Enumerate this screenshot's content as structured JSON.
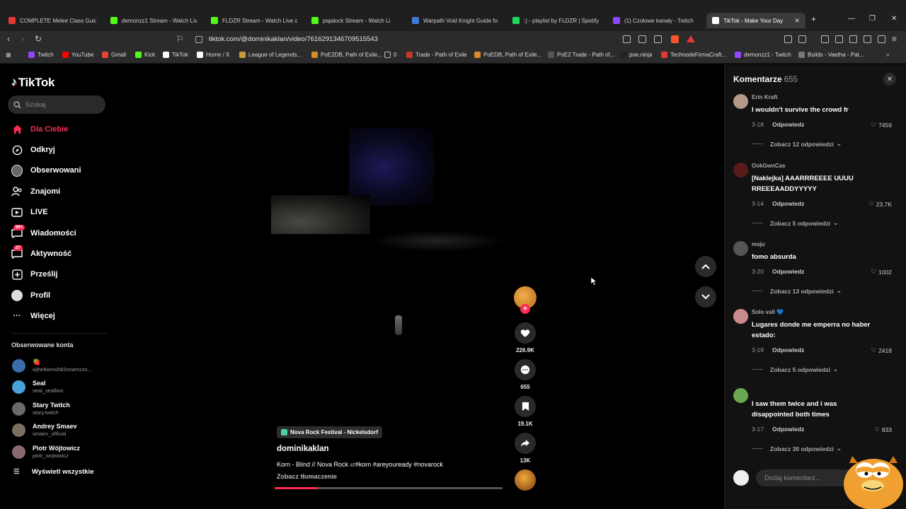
{
  "browser": {
    "tabs": [
      {
        "label": "COMPLETE Melee Class Guide",
        "color": "#e53935"
      },
      {
        "label": "demonzz1 Stream - Watch Live",
        "color": "#53fc18"
      },
      {
        "label": "FLDZR Stream - Watch Live on",
        "color": "#53fc18"
      },
      {
        "label": "pajalock Stream - Watch Li",
        "color": "#53fc18"
      },
      {
        "label": "Warpath Void Knight Guide fo",
        "color": "#3d7bd8"
      },
      {
        "label": ":) - playlist by FLDZR | Spotify",
        "color": "#1ed760"
      },
      {
        "label": "(1) Czołowe kanały - Twitch",
        "color": "#9146ff"
      },
      {
        "label": "TikTok - Make Your Day",
        "color": "#ffffff"
      }
    ],
    "url": "tiktok.com/@dominikaklan/video/7616291346709515543",
    "bookmarks": [
      {
        "label": "Twitch",
        "color": "#9146ff"
      },
      {
        "label": "YouTube",
        "color": "#ff0000"
      },
      {
        "label": "Gmail",
        "color": "#ea4335"
      },
      {
        "label": "Kick",
        "color": "#53fc18"
      },
      {
        "label": "TikTok",
        "color": "#ffffff"
      },
      {
        "label": "Home / X",
        "color": "#ffffff"
      },
      {
        "label": "League of Legends...",
        "color": "#c89b3c"
      },
      {
        "label": "PoE2DB, Path of Exile...",
        "color": "#d98a2b"
      },
      {
        "label": "0",
        "color": "#bbbbbb"
      },
      {
        "label": "Trade - Path of Exile",
        "color": "#c0392b"
      },
      {
        "label": "PoEDB, Path of Exile...",
        "color": "#d98a2b"
      },
      {
        "label": "PoE2 Trade - Path of...",
        "color": "#555555"
      },
      {
        "label": "poe.ninja",
        "color": "#222222"
      },
      {
        "label": "TechnodeFirmaCraft...",
        "color": "#e53935"
      },
      {
        "label": "demonzz1 - Twitch",
        "color": "#9146ff"
      },
      {
        "label": "Builds - Vaetha - Pat...",
        "color": "#777777"
      }
    ]
  },
  "sidebar": {
    "logo": "TikTok",
    "search_placeholder": "Szukaj",
    "nav": [
      {
        "label": "Dla Ciebie",
        "icon": "home-icon"
      },
      {
        "label": "Odkryj",
        "icon": "compass-icon"
      },
      {
        "label": "Obserwowani",
        "icon": "following-icon"
      },
      {
        "label": "Znajomi",
        "icon": "friends-icon"
      },
      {
        "label": "LIVE",
        "icon": "live-icon"
      },
      {
        "label": "Wiadomości",
        "icon": "messages-icon",
        "badge": "99+"
      },
      {
        "label": "Aktywność",
        "icon": "activity-icon",
        "badge": "27"
      },
      {
        "label": "Prześlij",
        "icon": "upload-icon"
      },
      {
        "label": "Profil",
        "icon": "profile-icon"
      },
      {
        "label": "Więcej",
        "icon": "more-icon"
      }
    ],
    "followed_title": "Obserwowane konta",
    "followed": [
      {
        "name": "🍓",
        "handle": "wjhe8wmsh82nnamzzs...",
        "color": "#3b6ea8"
      },
      {
        "name": "Seal",
        "handle": "seal_seallion",
        "color": "#4aa3d8"
      },
      {
        "name": "Stary Twitch",
        "handle": "stary.twitch",
        "color": "#6a6a6a"
      },
      {
        "name": "Andrey Smaev",
        "handle": "smaev_official",
        "color": "#7a7060"
      },
      {
        "name": "Piotr Wójtowicz",
        "handle": "piotr_wojtowicz",
        "color": "#8a6a70"
      }
    ],
    "see_all": "Wyświetl wszystkie"
  },
  "video": {
    "location": "Nova Rock Festival - Nickelsdorf",
    "author": "dominikaklan",
    "description_pre": "Korn - Blind // Nova Rock ",
    "description_at": "AT",
    "description_post": "#korn #areyouready #novarock",
    "translate": "Zobacz tłumaczenie",
    "progress": 0.19,
    "actions": {
      "likes": "226.9K",
      "comments": "655",
      "saves": "19.1K",
      "shares": "13K"
    }
  },
  "comments": {
    "title": "Komentarze",
    "count": "655",
    "input_placeholder": "Dodaj komentarz...",
    "items": [
      {
        "user": "Erin Kraft",
        "text": "I wouldn't survive the crowd fr",
        "date": "3-18",
        "reply": "Odpowiedz",
        "likes": "7459",
        "more": "Zobacz 12 odpowiedzi",
        "color": "#b39a88"
      },
      {
        "user": "OokGwnCas",
        "text": "[Naklejka] AAARRREEEE UUUU RREEEAADDYYYYY",
        "date": "3-14",
        "reply": "Odpowiedz",
        "likes": "23.7K",
        "more": "Zobacz 5 odpowiedzi",
        "color": "#5a1a1a"
      },
      {
        "user": "maju",
        "text": "fomo absurda",
        "date": "3-20",
        "reply": "Odpowiedz",
        "likes": "1002",
        "more": "Zobacz 13 odpowiedzi",
        "color": "#555555"
      },
      {
        "user": "Solo vall 💙",
        "text": "Lugares donde me emperra no haber estado:",
        "date": "3-19",
        "reply": "Odpowiedz",
        "likes": "2418",
        "more": "Zobacz 5 odpowiedzi",
        "color": "#c88a8a"
      },
      {
        "user": "",
        "text": "I saw them twice and i was disappointed both times",
        "date": "3-17",
        "reply": "Odpowiedz",
        "likes": "833",
        "more": "Zobacz 30 odpowiedzi",
        "color": "#6aa84f"
      }
    ]
  }
}
